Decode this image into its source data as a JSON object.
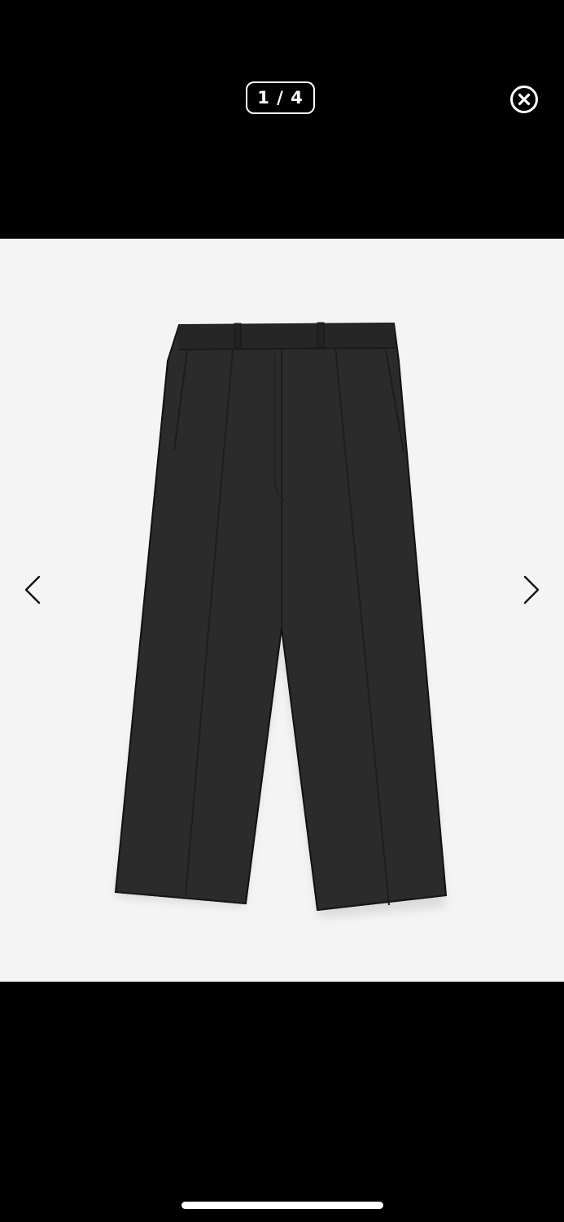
{
  "viewer": {
    "counter_text": "1 / 4",
    "current_index": 1,
    "total_images": 4
  },
  "icons": {
    "close": "close-circle-icon",
    "prev": "chevron-left-icon",
    "next": "chevron-right-icon"
  },
  "colors": {
    "background": "#000000",
    "image_background": "#f4f4f4",
    "product": "#2b2b2b",
    "foreground": "#ffffff"
  }
}
